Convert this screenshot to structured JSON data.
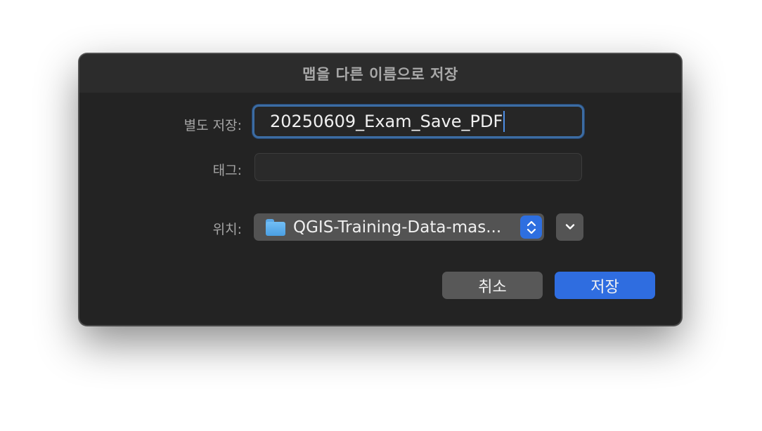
{
  "dialog": {
    "title": "맵을 다른 이름으로 저장"
  },
  "fields": {
    "save_as_label": "별도 저장:",
    "save_as_value": "20250609_Exam_Save_PDF",
    "tags_label": "태그:",
    "tags_value": "",
    "where_label": "위치:",
    "where_value": "QGIS-Training-Data-mas..."
  },
  "buttons": {
    "cancel": "취소",
    "save": "저장"
  },
  "colors": {
    "accent": "#2f6de0",
    "focus_ring": "#3c6ca3",
    "dialog_bg": "#232323"
  },
  "icons": {
    "where": "folder-icon",
    "stepper": "up-down-chevron-icon",
    "expand": "chevron-down-icon"
  }
}
